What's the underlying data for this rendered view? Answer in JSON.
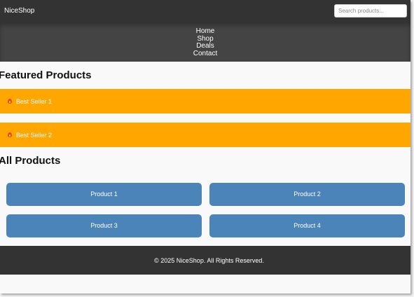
{
  "header": {
    "brand": "NiceShop",
    "search_placeholder": "Search products..."
  },
  "nav": {
    "items": [
      "Home",
      "Shop",
      "Deals",
      "Contact"
    ]
  },
  "featured": {
    "title": "Featured Products",
    "icon": "fire-icon",
    "items": [
      "Best Seller 1",
      "Best Seller 2"
    ]
  },
  "products": {
    "title": "All Products",
    "items": [
      "Product 1",
      "Product 2",
      "Product 3",
      "Product 4"
    ]
  },
  "footer": {
    "text": "© 2025 NiceShop. All Rights Reserved."
  },
  "colors": {
    "header_bg": "#333333",
    "nav_bg": "#444444",
    "featured_bg": "#ffa600",
    "product_bg": "#4a84b8",
    "page_bg": "#f9f9f9"
  }
}
